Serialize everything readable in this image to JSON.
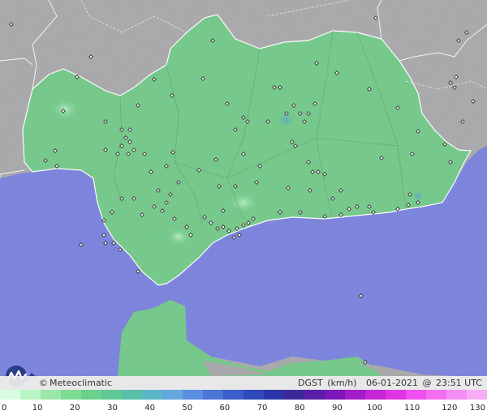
{
  "map": {
    "colors": {
      "sea": "#7b83dd",
      "land_outside": "#a9a9ab",
      "andalucia_fill": "#74c98a",
      "border_white": "#ffffff",
      "border_internal": "#5fa974"
    },
    "brand": {
      "copyright": "©",
      "name": "Meteoclimatic"
    },
    "status": {
      "variable": "DGST",
      "unit": "(km/h)",
      "date": "06-01-2021",
      "at": "@",
      "time": "23:51 UTC"
    },
    "logo_icon": "meteoclimatic-logo-icon",
    "scale": {
      "ticks": [
        "0",
        "10",
        "20",
        "30",
        "40",
        "50",
        "60",
        "70",
        "80",
        "90",
        "100",
        "110",
        "120",
        "130"
      ],
      "colors": [
        "#d8fde0",
        "#b9f5c4",
        "#9ae8a8",
        "#7ddc91",
        "#6ad18a",
        "#5fc894",
        "#57c0a7",
        "#5cb6c8",
        "#63a7dd",
        "#5a8fe0",
        "#4b74d7",
        "#3b5cc9",
        "#2f48bb",
        "#2a36a8",
        "#3a2a9a",
        "#5a1ea8",
        "#7d17b9",
        "#a11ccb",
        "#c526d6",
        "#df34e3",
        "#ed4ff0",
        "#f36ef2",
        "#f58ef5",
        "#f6adf6"
      ]
    }
  }
}
